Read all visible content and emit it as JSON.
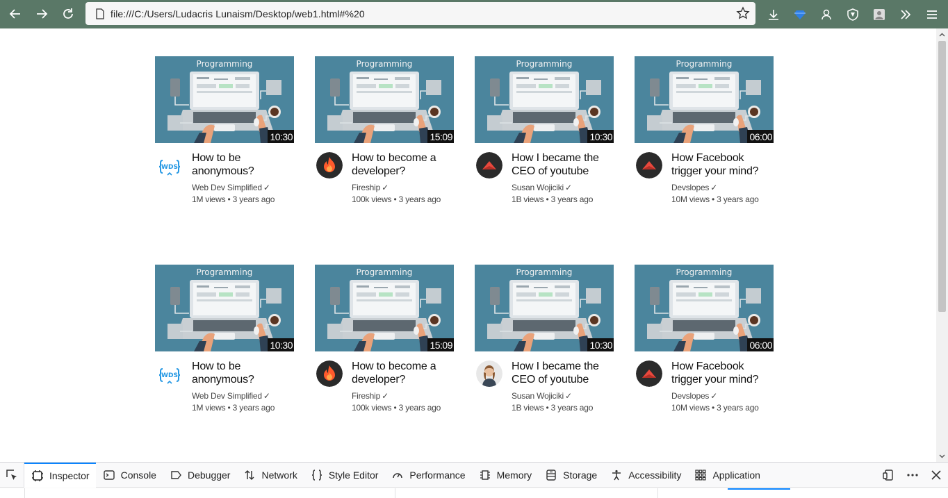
{
  "browser": {
    "url": "file:///C:/Users/Ludacris Lunaism/Desktop/web1.html#%20"
  },
  "thumbnail": {
    "tag": "Programming"
  },
  "videos": [
    {
      "title": "How to be anonymous?",
      "channel": "Web Dev Simplified",
      "meta": "1M views • 3 years ago",
      "duration": "10:30",
      "avatar": "wds"
    },
    {
      "title": "How to become a developer?",
      "channel": "Fireship",
      "meta": "100k views • 3 years ago",
      "duration": "15:09",
      "avatar": "fire"
    },
    {
      "title": "How I became the CEO of youtube",
      "channel": "Susan Wojiciki",
      "meta": "1B views • 3 years ago",
      "duration": "10:30",
      "avatar": "triangle"
    },
    {
      "title": "How Facebook trigger your mind?",
      "channel": "Devslopes",
      "meta": "10M views • 3 years ago",
      "duration": "06:00",
      "avatar": "triangle"
    },
    {
      "title": "How to be anonymous?",
      "channel": "Web Dev Simplified",
      "meta": "1M views • 3 years ago",
      "duration": "10:30",
      "avatar": "wds"
    },
    {
      "title": "How to become a developer?",
      "channel": "Fireship",
      "meta": "100k views • 3 years ago",
      "duration": "15:09",
      "avatar": "fire"
    },
    {
      "title": "How I became the CEO of youtube",
      "channel": "Susan Wojiciki",
      "meta": "1B views • 3 years ago",
      "duration": "10:30",
      "avatar": "person"
    },
    {
      "title": "How Facebook trigger your mind?",
      "channel": "Devslopes",
      "meta": "10M views • 3 years ago",
      "duration": "06:00",
      "avatar": "triangle"
    }
  ],
  "devtools": {
    "tabs": [
      {
        "label": "Inspector",
        "icon": "inspector-icon",
        "active": true
      },
      {
        "label": "Console",
        "icon": "console-icon"
      },
      {
        "label": "Debugger",
        "icon": "debugger-icon"
      },
      {
        "label": "Network",
        "icon": "network-icon"
      },
      {
        "label": "Style Editor",
        "icon": "style-editor-icon"
      },
      {
        "label": "Performance",
        "icon": "performance-icon"
      },
      {
        "label": "Memory",
        "icon": "memory-icon"
      },
      {
        "label": "Storage",
        "icon": "storage-icon"
      },
      {
        "label": "Accessibility",
        "icon": "accessibility-icon"
      },
      {
        "label": "Application",
        "icon": "application-icon"
      }
    ]
  },
  "colors": {
    "toolbar": "#5a7867",
    "thumbnail_bg": "#4b859d",
    "accent": "#0a84ff"
  }
}
